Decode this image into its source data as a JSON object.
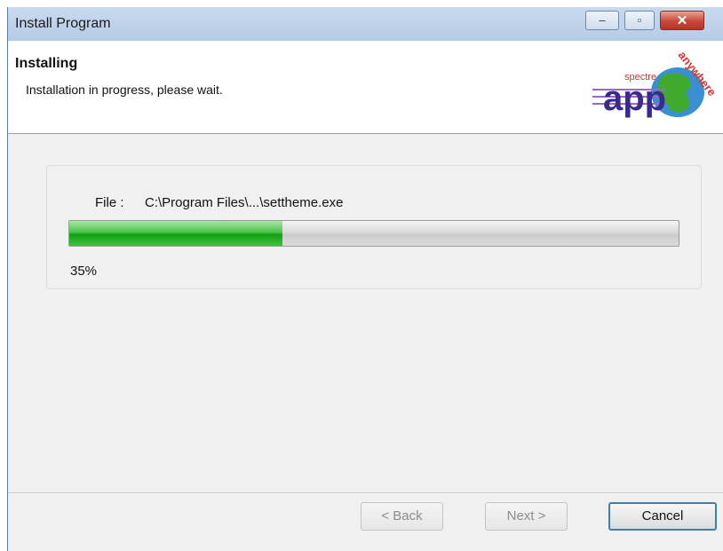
{
  "window": {
    "title": "Install Program"
  },
  "controls": {
    "minimize": "–",
    "maximize": "▫",
    "close": "✕"
  },
  "header": {
    "title": "Installing",
    "subtitle": "Installation in progress, please wait.",
    "logo": {
      "text_small": "spectre",
      "text_main": "app",
      "text_arc": "anywhere"
    }
  },
  "progress": {
    "file_label": "File :",
    "file_path": "C:\\Program Files\\...\\settheme.exe",
    "percent_text": "35%",
    "percent_value": 0.35,
    "fill_color": "#1fae1f"
  },
  "buttons": {
    "back": "< Back",
    "next": "Next >",
    "cancel": "Cancel"
  }
}
